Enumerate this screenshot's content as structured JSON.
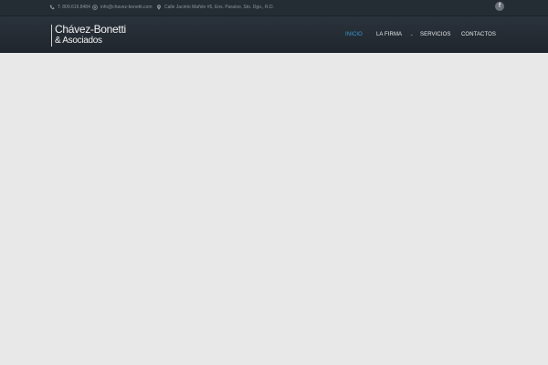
{
  "topbar": {
    "phone": "T. 809.616.8484",
    "email": "info@chavez-bonetti.com",
    "address": "Calle Jacinto Mañón #5, Ens. Paraíso, Sto. Dgo., R.D.",
    "facebook_label": "f"
  },
  "logo": {
    "name": "Chávez-Bonetti",
    "sub": "& Asociados"
  },
  "nav": {
    "items": [
      {
        "label": "INICIO"
      },
      {
        "label": "LA FIRMA",
        "caret": "⌄"
      },
      {
        "label": "SERVICIOS"
      },
      {
        "label": "CONTACTOS"
      }
    ]
  },
  "colors": {
    "topbar": "#242c34",
    "header": "#252c34",
    "accent": "#3b9bd3",
    "content": "#e8e8e8"
  }
}
